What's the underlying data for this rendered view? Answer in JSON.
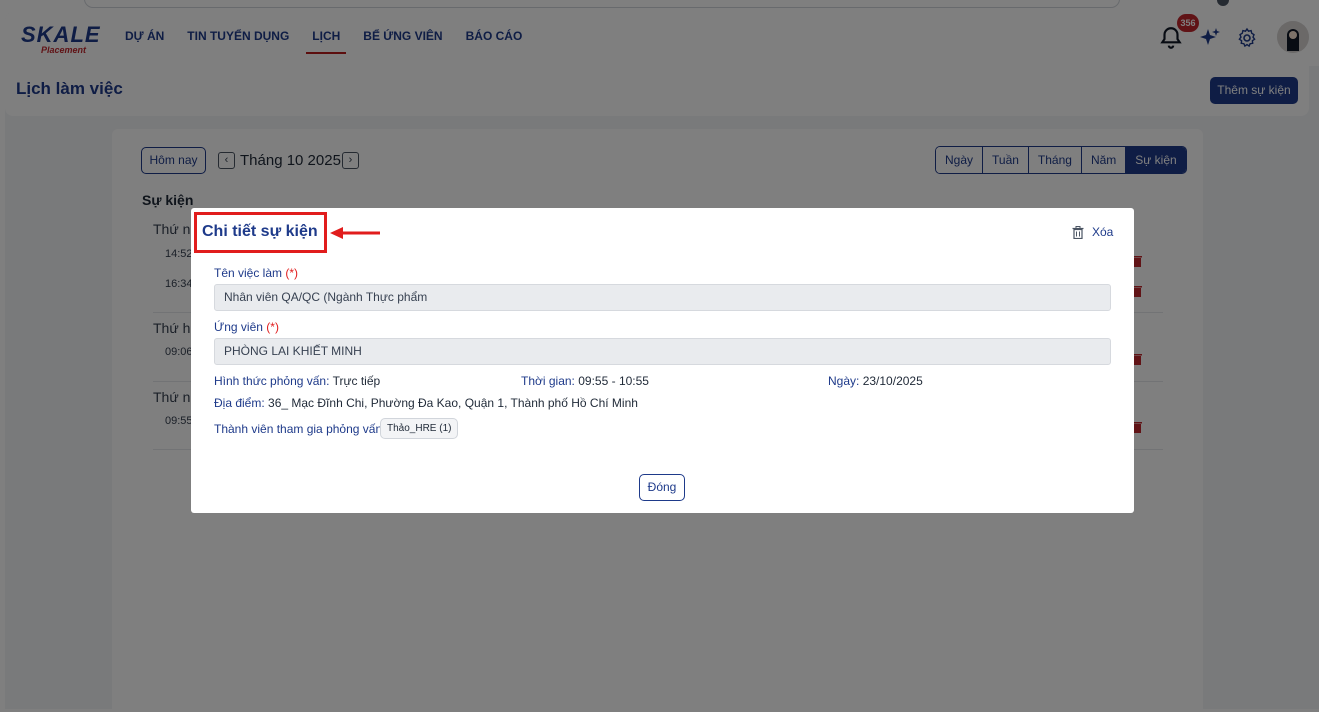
{
  "brand": {
    "logo_main": "SKALE",
    "logo_sub": "Placement"
  },
  "nav": {
    "items": [
      {
        "label": "DỰ ÁN",
        "active": false
      },
      {
        "label": "TIN TUYỂN DỤNG",
        "active": false
      },
      {
        "label": "LỊCH",
        "active": true
      },
      {
        "label": "BỂ ỨNG VIÊN",
        "active": false
      },
      {
        "label": "BÁO CÁO",
        "active": false
      }
    ],
    "notification_count": "356",
    "icons": [
      "bell-icon",
      "sparkle-icon",
      "gear-icon",
      "avatar"
    ]
  },
  "subheader": {
    "title": "Lịch làm việc",
    "add_event_label": "Thêm sự kiện"
  },
  "calendar": {
    "today_label": "Hôm nay",
    "month_label": "Tháng 10 2025",
    "views": [
      "Ngày",
      "Tuần",
      "Tháng",
      "Năm",
      "Sự kiện"
    ],
    "active_view": "Sự kiện",
    "events_heading": "Sự kiện",
    "days": [
      {
        "label": "Thứ n",
        "times": [
          "14:52",
          "16:34"
        ]
      },
      {
        "label": "Thứ h",
        "times": [
          "09:06"
        ]
      },
      {
        "label": "Thứ n",
        "times": [
          "09:55"
        ]
      }
    ]
  },
  "modal": {
    "title": "Chi tiết sự kiện",
    "delete_label": "Xóa",
    "job_label": "Tên việc làm",
    "job_required": "(*)",
    "job_value": "Nhân viên QA/QC (Ngành Thực phẩm",
    "candidate_label": "Ứng viên",
    "candidate_required": "(*)",
    "candidate_value": "PHÒNG LAI KHIẾT MINH",
    "interview_type_label": "Hình thức phỏng vấn:",
    "interview_type_value": "Trực tiếp",
    "time_label": "Thời gian:",
    "time_value": "09:55 - 10:55",
    "date_label": "Ngày:",
    "date_value": "23/10/2025",
    "location_label": "Địa điểm:",
    "location_value": "36_ Mạc Đĩnh Chi, Phường Đa Kao, Quận 1, Thành phố Hồ Chí Minh",
    "members_label": "Thành viên tham gia phỏng vấn:",
    "members": [
      "Thảo_HRE (1)"
    ],
    "close_label": "Đóng"
  },
  "colors": {
    "primary": "#1e3a8a",
    "danger": "#c0262d",
    "highlight": "#e11d1d"
  }
}
